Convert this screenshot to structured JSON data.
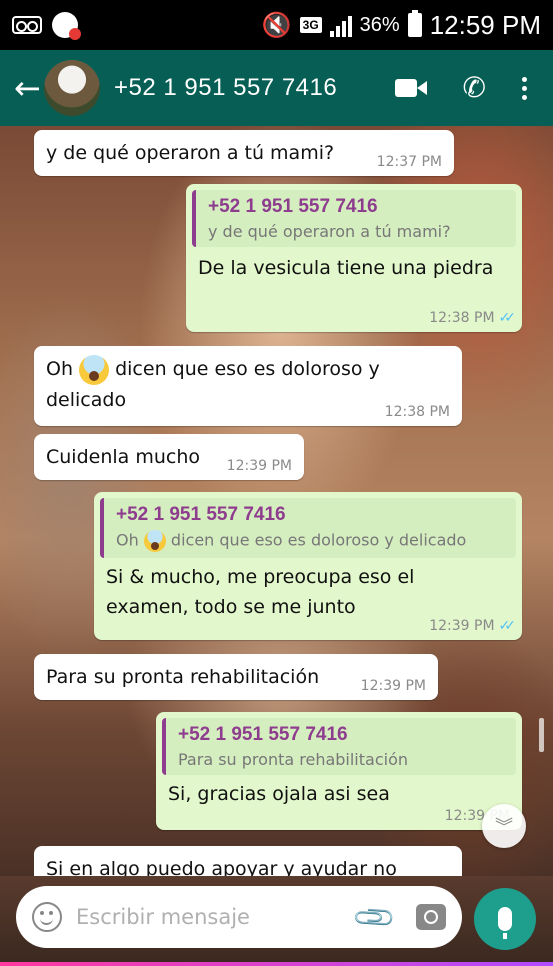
{
  "status_bar": {
    "network": "3G",
    "battery": "36%",
    "time": "12:59 PM"
  },
  "header": {
    "contact": "+52 1 951 557 7416"
  },
  "messages": [
    {
      "direction": "in",
      "text": "y de qué operaron a tú mami?",
      "time": "12:37 PM"
    },
    {
      "direction": "out",
      "quote_author": "+52 1 951 557 7416",
      "quote_text": "y de qué operaron a tú mami?",
      "text": "De la vesicula tiene una piedra",
      "time": "12:38 PM",
      "status": "read"
    },
    {
      "direction": "in",
      "text_before_emoji": "Oh",
      "text_after_emoji": "dicen que eso es doloroso y",
      "text_line2": "delicado",
      "time": "12:38 PM",
      "emoji": "face-screaming-in-fear"
    },
    {
      "direction": "in",
      "text": "Cuidenla mucho",
      "time": "12:39 PM"
    },
    {
      "direction": "out",
      "quote_author": "+52 1 951 557 7416",
      "quote_before_emoji": "Oh",
      "quote_after_emoji": "dicen que eso es doloroso y delicado",
      "text_line1": "Si & mucho, me preocupa eso el",
      "text_line2": "examen, todo se me junto",
      "time": "12:39 PM",
      "status": "read"
    },
    {
      "direction": "in",
      "text": "Para su pronta rehabilitación",
      "time": "12:39 PM"
    },
    {
      "direction": "out",
      "quote_author": "+52 1 951 557 7416",
      "quote_text": "Para su pronta rehabilitación",
      "text": "Si, gracias ojala asi sea",
      "time": "12:39 PM"
    },
    {
      "direction": "in",
      "text": "Si en algo puedo apoyar y ayudar no"
    }
  ],
  "input": {
    "placeholder": "Escribir mensaje"
  },
  "colors": {
    "app_bar": "#075e54",
    "outgoing_bubble": "#e2f7cb",
    "quote_accent": "#8e3c8e",
    "read_ticks": "#4fc3f7",
    "mic_button": "#1e9e8c"
  },
  "icons": {
    "back": "arrow-left-icon",
    "video": "video-call-icon",
    "call": "phone-icon",
    "menu": "more-vert-icon",
    "emoji": "emoji-icon",
    "attach": "paperclip-icon",
    "camera": "camera-icon",
    "mic": "mic-icon",
    "scroll_down": "chevron-down-icon"
  }
}
